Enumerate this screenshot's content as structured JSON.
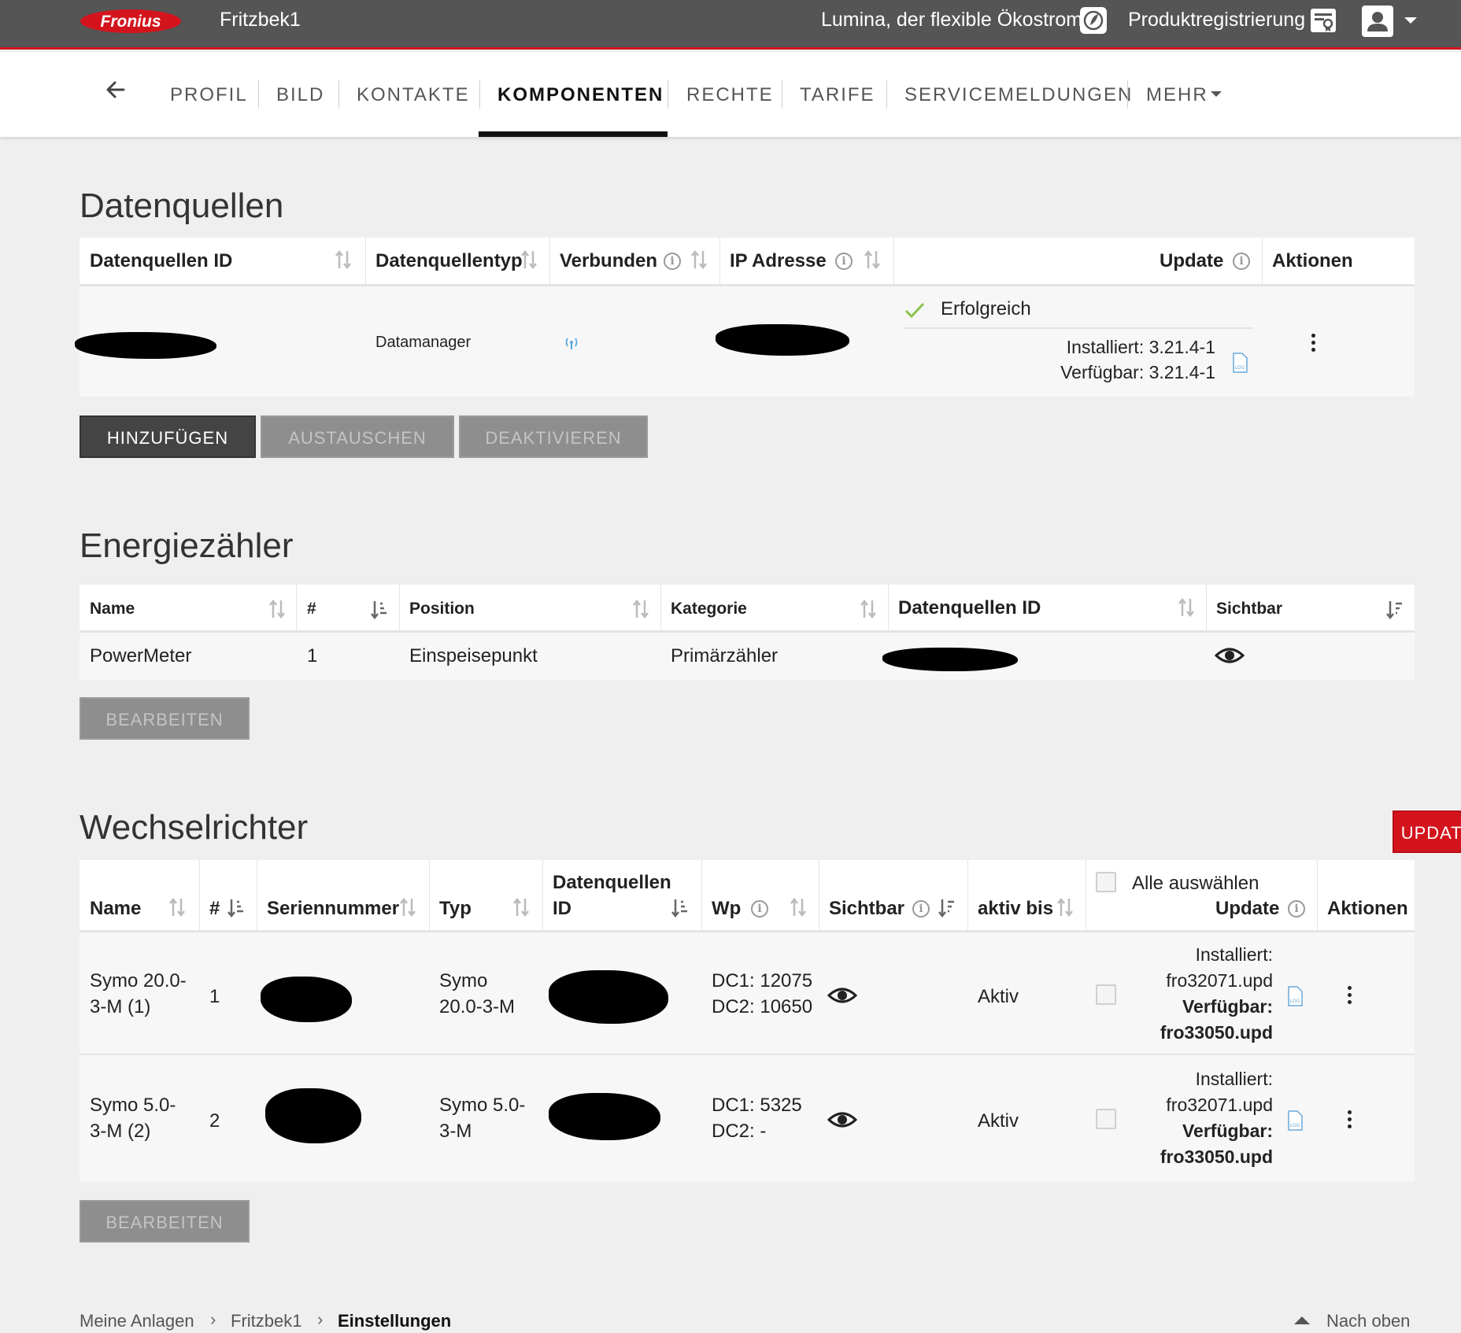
{
  "topbar": {
    "logo_text": "Fronius",
    "plant_name": "Fritzbek1",
    "lumina_link": "Lumina, der flexible Ökostrom",
    "product_registration": "Produktregistrierung",
    "colors": {
      "bar": "#555555",
      "accent": "#d3141d"
    }
  },
  "nav": {
    "tabs": [
      "PROFIL",
      "BILD",
      "KONTAKTE",
      "KOMPONENTEN",
      "RECHTE",
      "TARIFE",
      "SERVICEMELDUNGEN",
      "MEHR"
    ],
    "active_tab": "KOMPONENTEN"
  },
  "datenquellen": {
    "title": "Datenquellen",
    "headers": [
      "Datenquellen ID",
      "Datenquellentyp",
      "Verbunden",
      "IP Adresse",
      "Update",
      "Aktionen"
    ],
    "row": {
      "type": "Datamanager",
      "update_status": "Erfolgreich",
      "installed": "Installiert: 3.21.4-1",
      "available": "Verfügbar: 3.21.4-1"
    },
    "buttons": {
      "add": "HINZUFÜGEN",
      "replace": "AUSTAUSCHEN",
      "deactivate": "DEAKTIVIEREN"
    }
  },
  "energiezaehler": {
    "title": "Energiezähler",
    "headers": [
      "Name",
      "#",
      "Position",
      "Kategorie",
      "Datenquellen ID",
      "Sichtbar"
    ],
    "rows": [
      {
        "name": "PowerMeter",
        "num": "1",
        "position": "Einspeisepunkt",
        "category": "Primärzähler"
      }
    ],
    "edit_button": "BEARBEITEN"
  },
  "wechselrichter": {
    "title": "Wechselrichter",
    "update_button": "UPDATE",
    "headers": {
      "name": "Name",
      "num": "#",
      "serial": "Seriennummer",
      "type": "Typ",
      "ds_id_1": "Datenquellen",
      "ds_id_2": "ID",
      "wp": "Wp",
      "visible": "Sichtbar",
      "active_until": "aktiv bis",
      "select_all": "Alle auswählen",
      "update": "Update",
      "actions": "Aktionen"
    },
    "rows": [
      {
        "name_1": "Symo 20.0-",
        "name_2": "3-M (1)",
        "num": "1",
        "type_1": "Symo",
        "type_2": "20.0-3-M",
        "dc1": "DC1: 12075",
        "dc2": "DC2: 10650",
        "active": "Aktiv",
        "installed_label": "Installiert:",
        "installed_file": "fro32071.upd",
        "available_label": "Verfügbar:",
        "available_file": "fro33050.upd"
      },
      {
        "name_1": "Symo 5.0-",
        "name_2": "3-M (2)",
        "num": "2",
        "type_1": "Symo 5.0-",
        "type_2": "3-M",
        "dc1": "DC1: 5325",
        "dc2": "DC2: -",
        "active": "Aktiv",
        "installed_label": "Installiert:",
        "installed_file": "fro32071.upd",
        "available_label": "Verfügbar:",
        "available_file": "fro33050.upd"
      }
    ],
    "edit_button": "BEARBEITEN"
  },
  "footer": {
    "breadcrumb": [
      "Meine Anlagen",
      "Fritzbek1",
      "Einstellungen"
    ],
    "to_top": "Nach oben"
  }
}
